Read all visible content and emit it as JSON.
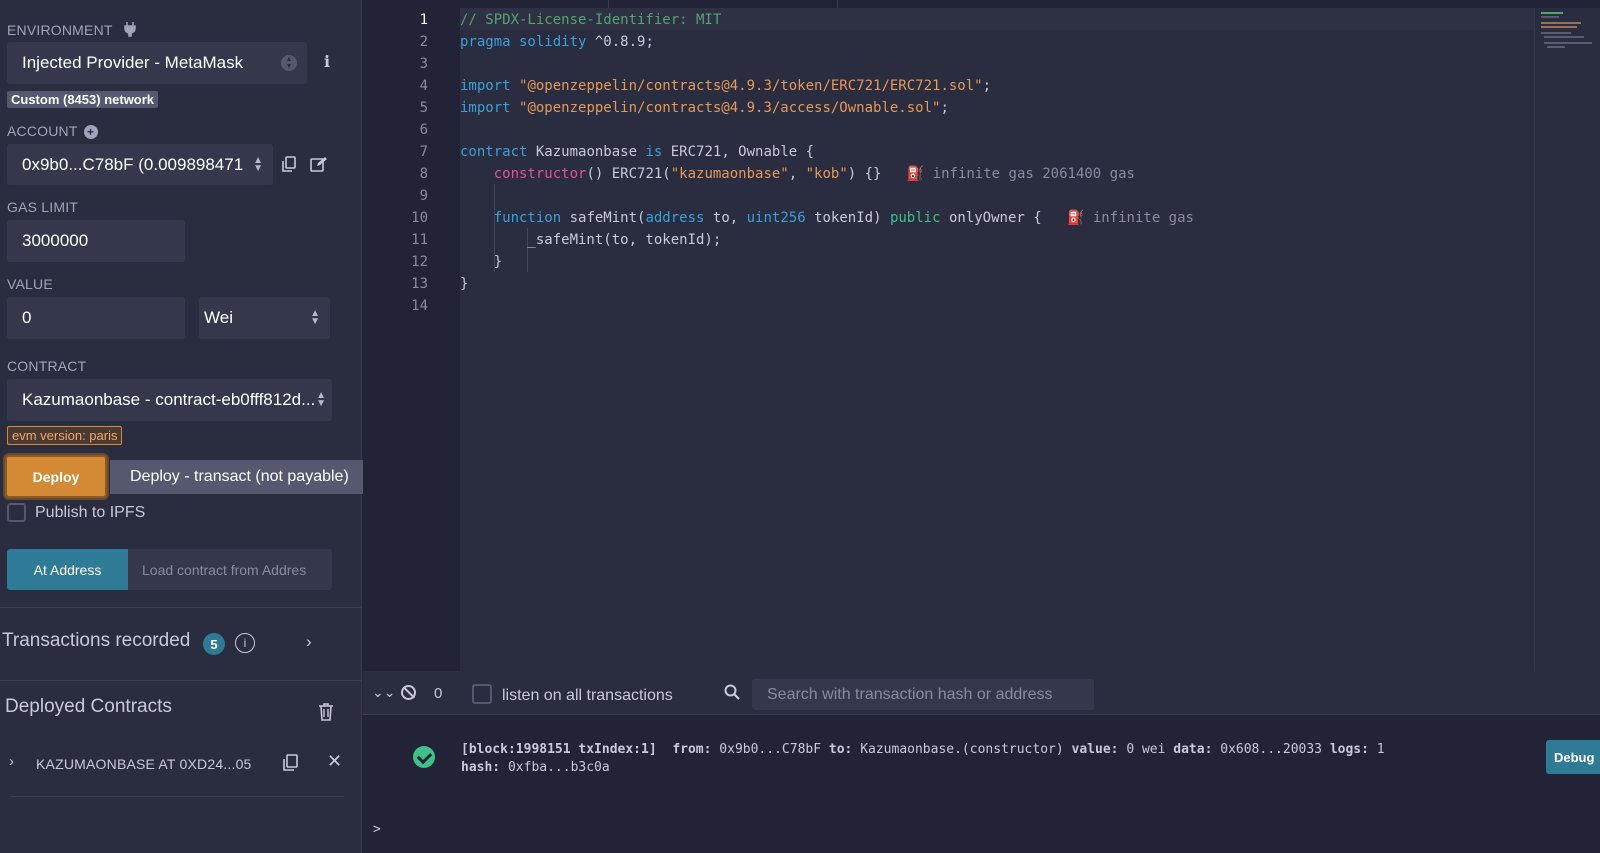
{
  "sidebar": {
    "environment_label": "ENVIRONMENT",
    "environment_value": "Injected Provider - MetaMask",
    "network_badge": "Custom (8453) network",
    "account_label": "ACCOUNT",
    "account_value": "0x9b0...C78bF (0.00989847‌1",
    "gas_limit_label": "GAS LIMIT",
    "gas_limit_value": "3000000",
    "value_label": "VALUE",
    "value_amount": "0",
    "value_unit": "Wei",
    "contract_label": "CONTRACT",
    "contract_value": "Kazumaonbase - contract-eb0fff812d...",
    "evm_badge": "evm version: paris",
    "deploy_button": "Deploy",
    "deploy_tooltip": "Deploy - transact (not payable)",
    "publish_ipfs": "Publish to IPFS",
    "at_address_button": "At Address",
    "load_contract_placeholder": "Load contract from Addres",
    "transactions_recorded": "Transactions recorded",
    "transactions_count": "5",
    "deployed_contracts": "Deployed Contracts",
    "deployed_item": "KAZUMAONBASE AT 0XD24...05"
  },
  "editor": {
    "line_numbers": [
      "1",
      "2",
      "3",
      "4",
      "5",
      "6",
      "7",
      "8",
      "9",
      "10",
      "11",
      "12",
      "13",
      "14"
    ],
    "gas_line8": "infinite gas 2061400 gas",
    "gas_line10": "infinite gas"
  },
  "terminal": {
    "count": "0",
    "listen_label": "listen on all transactions",
    "search_placeholder": "Search with transaction hash or address",
    "tx_block": "[block:1998151 txIndex:1]",
    "tx_from_label": "from:",
    "tx_from": "0x9b0...C78bF",
    "tx_to_label": "to:",
    "tx_to": "Kazumaonbase.(constructor)",
    "tx_value_label": "value:",
    "tx_value": "0 wei",
    "tx_data_label": "data:",
    "tx_data": "0x608...20033",
    "tx_logs_label": "logs:",
    "tx_logs": "1",
    "tx_hash_label": "hash:",
    "tx_hash": "0xfba...b3c0a",
    "debug_button": "Debug",
    "prompt": ">"
  }
}
